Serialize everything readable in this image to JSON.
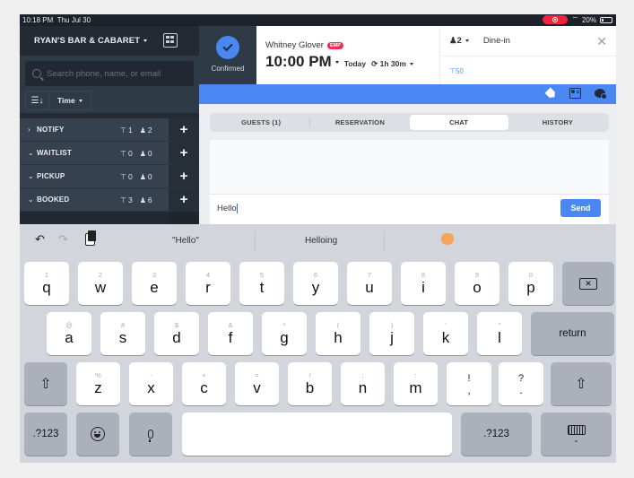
{
  "status_bar": {
    "time": "10:18 PM",
    "date": "Thu Jul 30",
    "battery": "20%"
  },
  "sidebar": {
    "venue_name": "RYAN'S BAR & CABARET",
    "search_placeholder": "Search phone, name, or email",
    "sort_label": "Time",
    "sections": [
      {
        "label": "NOTIFY",
        "expanded": false,
        "tables": "1",
        "guests": "2"
      },
      {
        "label": "WAITLIST",
        "expanded": true,
        "tables": "0",
        "guests": "0"
      },
      {
        "label": "PICKUP",
        "expanded": true,
        "tables": "0",
        "guests": "0"
      },
      {
        "label": "BOOKED",
        "expanded": true,
        "tables": "3",
        "guests": "6"
      }
    ]
  },
  "reservation": {
    "status": "Confirmed",
    "guest_name": "Whitney Glover",
    "badge": "EMP",
    "time": "10:00 PM",
    "day": "Today",
    "duration": "1h 30m",
    "party_size": "2",
    "type": "Dine-in",
    "table": "50"
  },
  "tabs": [
    {
      "label": "GUESTS (1)",
      "active": false
    },
    {
      "label": "RESERVATION",
      "active": false
    },
    {
      "label": "CHAT",
      "active": true
    },
    {
      "label": "HISTORY",
      "active": false
    }
  ],
  "chat": {
    "input_value": "Hello",
    "send_label": "Send"
  },
  "keyboard": {
    "suggestions": [
      "\"Hello\"",
      "Helloing"
    ],
    "row1": [
      [
        "1",
        "q"
      ],
      [
        "2",
        "w"
      ],
      [
        "3",
        "e"
      ],
      [
        "4",
        "r"
      ],
      [
        "5",
        "t"
      ],
      [
        "6",
        "y"
      ],
      [
        "7",
        "u"
      ],
      [
        "8",
        "i"
      ],
      [
        "9",
        "o"
      ],
      [
        "0",
        "p"
      ]
    ],
    "row2": [
      [
        "@",
        "a"
      ],
      [
        "#",
        "s"
      ],
      [
        "$",
        "d"
      ],
      [
        "&",
        "f"
      ],
      [
        "*",
        "g"
      ],
      [
        "(",
        "h"
      ],
      [
        ")",
        "j"
      ],
      [
        "'",
        "k"
      ],
      [
        "\"",
        "l"
      ]
    ],
    "row3": [
      [
        "%",
        "z"
      ],
      [
        "-",
        "x"
      ],
      [
        "+",
        "c"
      ],
      [
        "=",
        "v"
      ],
      [
        "/",
        "b"
      ],
      [
        ";",
        "n"
      ],
      [
        ":",
        "m"
      ]
    ],
    "row3_punct": [
      [
        "!",
        ","
      ],
      [
        "?",
        "."
      ]
    ],
    "return_label": "return",
    "numbers_label": ".?123"
  },
  "colors": {
    "accent": "#4a87f0",
    "sidebar_bg": "#2f3a47",
    "badge": "#ee2e4f",
    "recording": "#f0233b"
  }
}
